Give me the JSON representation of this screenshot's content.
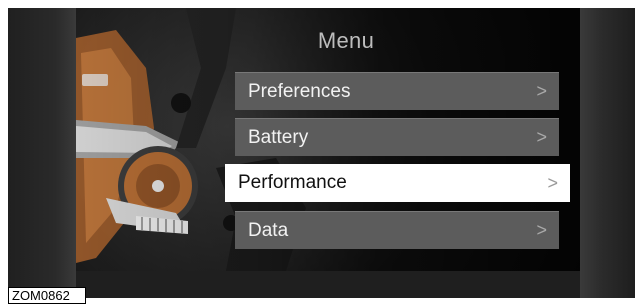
{
  "screen": {
    "title": "Menu",
    "items": [
      {
        "label": "Preferences",
        "icon": "chevron-right-icon",
        "glyph": ">",
        "selected": false
      },
      {
        "label": "Battery",
        "icon": "chevron-right-icon",
        "glyph": ">",
        "selected": false
      },
      {
        "label": "Performance",
        "icon": "chevron-right-icon",
        "glyph": ">",
        "selected": true
      },
      {
        "label": "Data",
        "icon": "chevron-right-icon",
        "glyph": ">",
        "selected": false
      }
    ]
  },
  "figure": {
    "reference_label": "ZOM0862"
  },
  "colors": {
    "item_background": "#5c5c5c",
    "selected_background": "#ffffff",
    "title_text": "#bdbdbd",
    "motor_copper": "#b06a33"
  }
}
